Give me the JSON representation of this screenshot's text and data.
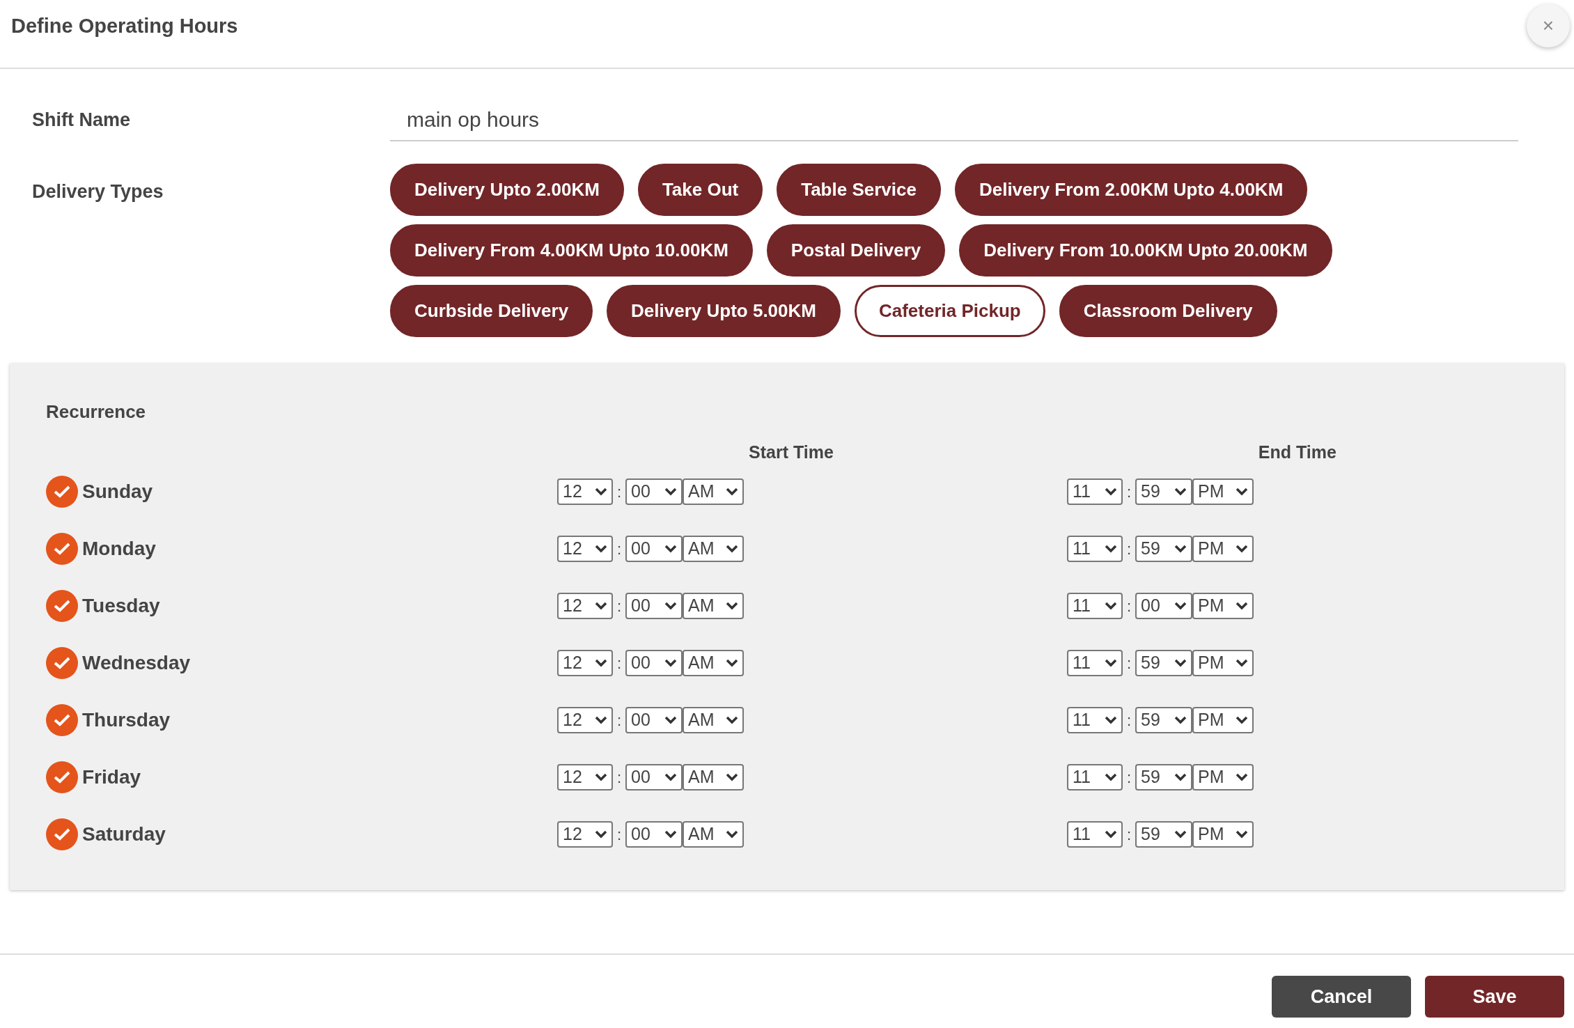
{
  "dialog": {
    "title": "Define Operating Hours",
    "close_label": "×"
  },
  "shift_name": {
    "label": "Shift Name",
    "value": "main op hours"
  },
  "delivery_types": {
    "label": "Delivery Types",
    "items": [
      {
        "label": "Delivery Upto 2.00KM",
        "selected": true
      },
      {
        "label": "Take Out",
        "selected": true
      },
      {
        "label": "Table Service",
        "selected": true
      },
      {
        "label": "Delivery From 2.00KM Upto 4.00KM",
        "selected": true
      },
      {
        "label": "Delivery From 4.00KM Upto 10.00KM",
        "selected": true
      },
      {
        "label": "Postal Delivery",
        "selected": true
      },
      {
        "label": "Delivery From 10.00KM Upto 20.00KM",
        "selected": true
      },
      {
        "label": "Curbside Delivery",
        "selected": true
      },
      {
        "label": "Delivery Upto 5.00KM",
        "selected": true
      },
      {
        "label": "Cafeteria Pickup",
        "selected": false
      },
      {
        "label": "Classroom Delivery",
        "selected": true
      }
    ]
  },
  "recurrence": {
    "title": "Recurrence",
    "start_header": "Start Time",
    "end_header": "End Time",
    "separator": ":",
    "days": [
      {
        "day": "Sunday",
        "checked": true,
        "start": [
          "12",
          "00",
          "AM"
        ],
        "end": [
          "11",
          "59",
          "PM"
        ]
      },
      {
        "day": "Monday",
        "checked": true,
        "start": [
          "12",
          "00",
          "AM"
        ],
        "end": [
          "11",
          "59",
          "PM"
        ]
      },
      {
        "day": "Tuesday",
        "checked": true,
        "start": [
          "12",
          "00",
          "AM"
        ],
        "end": [
          "11",
          "00",
          "PM"
        ]
      },
      {
        "day": "Wednesday",
        "checked": true,
        "start": [
          "12",
          "00",
          "AM"
        ],
        "end": [
          "11",
          "59",
          "PM"
        ]
      },
      {
        "day": "Thursday",
        "checked": true,
        "start": [
          "12",
          "00",
          "AM"
        ],
        "end": [
          "11",
          "59",
          "PM"
        ]
      },
      {
        "day": "Friday",
        "checked": true,
        "start": [
          "12",
          "00",
          "AM"
        ],
        "end": [
          "11",
          "59",
          "PM"
        ]
      },
      {
        "day": "Saturday",
        "checked": true,
        "start": [
          "12",
          "00",
          "AM"
        ],
        "end": [
          "11",
          "59",
          "PM"
        ]
      }
    ]
  },
  "footer": {
    "buttons": [
      {
        "label": "Cancel",
        "kind": "secondary"
      },
      {
        "label": "Save",
        "kind": "primary"
      }
    ]
  }
}
